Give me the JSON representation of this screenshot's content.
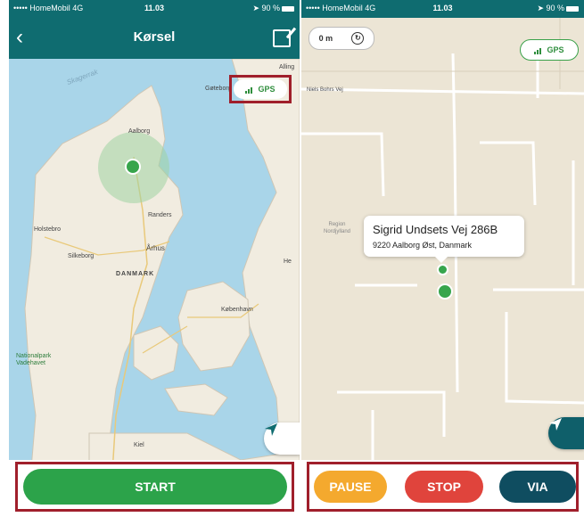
{
  "left_screen": {
    "status": {
      "carrier": "••••• HomeMobil 4G",
      "time": "11.03",
      "battery": "90 %"
    },
    "title": "Kørsel",
    "gps_label": "GPS",
    "map_labels": {
      "skagerrak": "Skagerrak",
      "gateborg": "Gøteborg",
      "alingsas": "Alling",
      "aalborg": "Aalborg",
      "randers": "Randers",
      "holstebro": "Holstebro",
      "silkeborg": "Silkeborg",
      "aarhus": "Århus",
      "danmark": "DANMARK",
      "kobenhavn": "København",
      "nationalpark": "Nationalpark Vadehavet",
      "kiel": "Kiel",
      "he": "He"
    },
    "start_label": "START"
  },
  "right_screen": {
    "status": {
      "carrier": "••••• HomeMobil 4G",
      "time": "11.03",
      "battery": "90 %"
    },
    "distance": "0 m",
    "gps_label": "GPS",
    "road_label": "Niels Bohrs Vej",
    "region_label": "Region Nordjylland",
    "callout": {
      "street": "Sigrid Undsets Vej 286B",
      "city": "9220 Aalborg Øst, Danmark"
    },
    "pause_label": "PAUSE",
    "stop_label": "STOP",
    "via_label": "VIA"
  },
  "colors": {
    "header": "#0f6c70",
    "start": "#2ca34a",
    "pause": "#f4a92e",
    "stop": "#e0443c",
    "via": "#0f4d60",
    "highlight": "#a01f2b"
  }
}
